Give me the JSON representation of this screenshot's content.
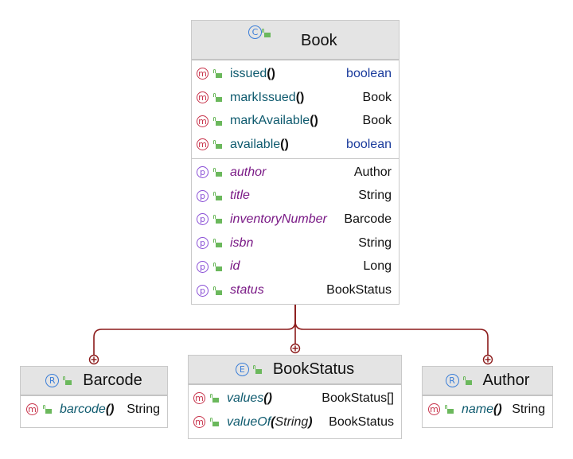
{
  "classes": {
    "book": {
      "name": "Book",
      "kind_icon": "C",
      "methods": [
        {
          "name": "issued",
          "params": "()",
          "type": "boolean",
          "type_keyword": true
        },
        {
          "name": "markIssued",
          "params": "()",
          "type": "Book",
          "type_keyword": false
        },
        {
          "name": "markAvailable",
          "params": "()",
          "type": "Book",
          "type_keyword": false
        },
        {
          "name": "available",
          "params": "()",
          "type": "boolean",
          "type_keyword": true
        }
      ],
      "fields": [
        {
          "name": "author",
          "type": "Author"
        },
        {
          "name": "title",
          "type": "String"
        },
        {
          "name": "inventoryNumber",
          "type": "Barcode"
        },
        {
          "name": "isbn",
          "type": "String"
        },
        {
          "name": "id",
          "type": "Long"
        },
        {
          "name": "status",
          "type": "BookStatus"
        }
      ]
    },
    "barcode": {
      "name": "Barcode",
      "kind_icon": "R",
      "methods": [
        {
          "name": "barcode",
          "params_open": "(",
          "params_inner": "",
          "params_close": ")",
          "type": "String"
        }
      ]
    },
    "bookstatus": {
      "name": "BookStatus",
      "kind_icon": "E",
      "methods": [
        {
          "name": "values",
          "params_open": "(",
          "params_inner": "",
          "params_close": ")",
          "type": "BookStatus[]"
        },
        {
          "name": "valueOf",
          "params_open": "(",
          "params_inner": "String",
          "params_close": ")",
          "type": "BookStatus"
        }
      ]
    },
    "author": {
      "name": "Author",
      "kind_icon": "R",
      "methods": [
        {
          "name": "name",
          "params_open": "(",
          "params_inner": "",
          "params_close": ")",
          "type": "String"
        }
      ]
    }
  },
  "icons": {
    "method": "m",
    "property": "p"
  },
  "colors": {
    "connector": "#8b1a1a",
    "method_badge": "#c7324a",
    "property_badge": "#8a4fd6",
    "class_badge": "#3b7ed8",
    "public_lock": "#6bb85c"
  }
}
